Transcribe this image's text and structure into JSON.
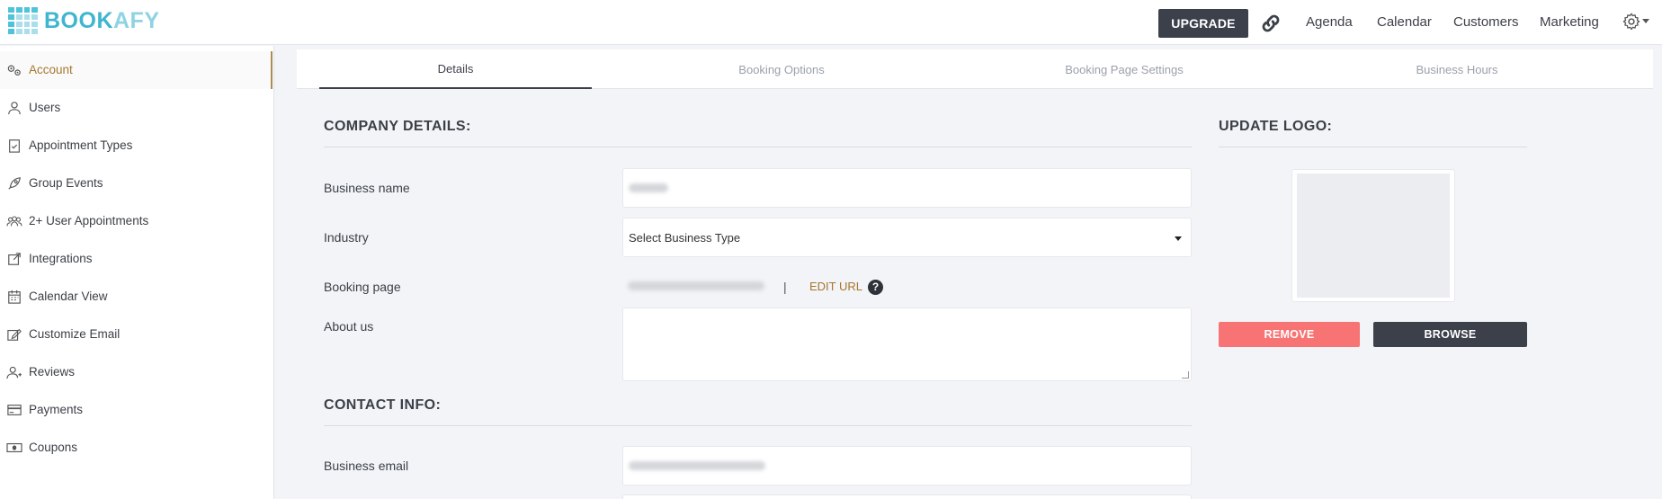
{
  "app": {
    "logo_text_bold": "BOOK",
    "logo_text_light": "AFY",
    "brand_color": "#3fb6cf",
    "accent_color": "#a8762e"
  },
  "topbar": {
    "upgrade_label": "UPGRADE",
    "nav": [
      "Agenda",
      "Calendar",
      "Customers",
      "Marketing"
    ],
    "icons": [
      "link-icon",
      "gear-icon",
      "chevron-down-icon"
    ]
  },
  "sidebar": {
    "items": [
      {
        "label": "Account",
        "icon": "gears-icon",
        "active": true
      },
      {
        "label": "Users",
        "icon": "user-icon"
      },
      {
        "label": "Appointment Types",
        "icon": "clipboard-check-icon"
      },
      {
        "label": "Group Events",
        "icon": "rocket-icon"
      },
      {
        "label": "2+ User Appointments",
        "icon": "users-group-icon"
      },
      {
        "label": "Integrations",
        "icon": "external-link-icon"
      },
      {
        "label": "Calendar View",
        "icon": "calendar-icon"
      },
      {
        "label": "Customize Email",
        "icon": "edit-icon"
      },
      {
        "label": "Reviews",
        "icon": "user-plus-icon"
      },
      {
        "label": "Payments",
        "icon": "credit-card-icon"
      },
      {
        "label": "Coupons",
        "icon": "money-icon"
      }
    ]
  },
  "tabs": {
    "items": [
      {
        "label": "Details",
        "active": true
      },
      {
        "label": "Booking Options"
      },
      {
        "label": "Booking Page Settings"
      },
      {
        "label": "Business Hours"
      }
    ]
  },
  "company": {
    "title": "COMPANY DETAILS:",
    "business_name_label": "Business name",
    "industry_label": "Industry",
    "industry_value": "Select Business Type",
    "booking_page_label": "Booking page",
    "separator": "|",
    "edit_url_label": "EDIT URL",
    "help_glyph": "?",
    "about_label": "About us"
  },
  "contact": {
    "title": "CONTACT INFO:",
    "business_email_label": "Business email"
  },
  "logo_panel": {
    "title": "UPDATE LOGO:",
    "remove_label": "REMOVE",
    "browse_label": "BROWSE"
  }
}
